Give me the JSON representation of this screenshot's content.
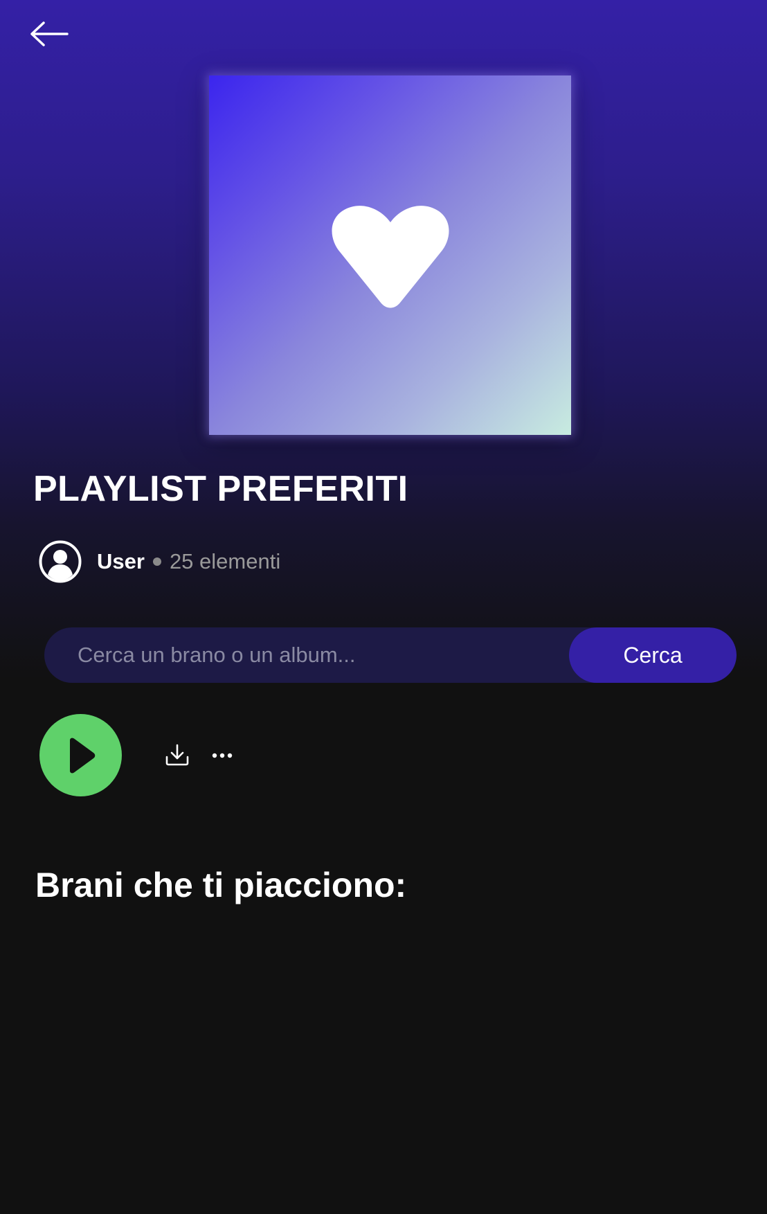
{
  "header": {
    "back_icon": "arrow-left-icon"
  },
  "playlist": {
    "cover_icon": "heart-icon",
    "title": "PLAYLIST PREFERITI",
    "owner": "User",
    "item_count": "25 elementi"
  },
  "search": {
    "placeholder": "Cerca un brano o un album...",
    "value": "",
    "button_label": "Cerca"
  },
  "actions": {
    "play_icon": "play-icon",
    "download_icon": "download-icon",
    "more_icon": "more-horizontal-icon"
  },
  "songs_section": {
    "heading": "Brani che ti piacciono:"
  },
  "colors": {
    "background": "#111111",
    "gradient_top": "#3420a6",
    "accent": "#3420a6",
    "search_bg": "#1d1a46",
    "play_green": "#5fd16a",
    "muted_text": "#9a9a9a"
  }
}
